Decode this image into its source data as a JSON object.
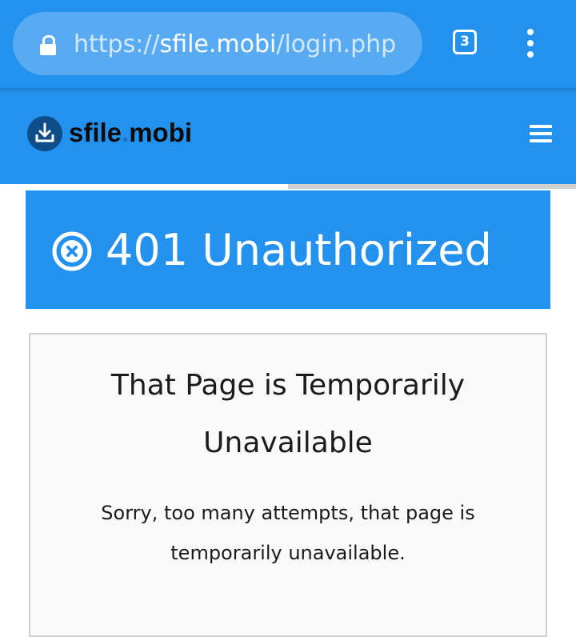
{
  "browser": {
    "url_scheme": "https://",
    "url_host": "sfile.mobi",
    "url_path": "/login.php",
    "tab_count": "3"
  },
  "site": {
    "logo_name": "sfile",
    "logo_dot": ".",
    "logo_tld": "mobi"
  },
  "page_load_progress": 0.5,
  "error": {
    "title": "401 Unauthorized"
  },
  "message": {
    "heading": "That Page is Temporarily Unavailable",
    "body": "Sorry, too many attempts, that page is temporarily unavailable."
  },
  "colors": {
    "brand_blue": "#2392ee",
    "logo_dark": "#0f4d8a"
  }
}
